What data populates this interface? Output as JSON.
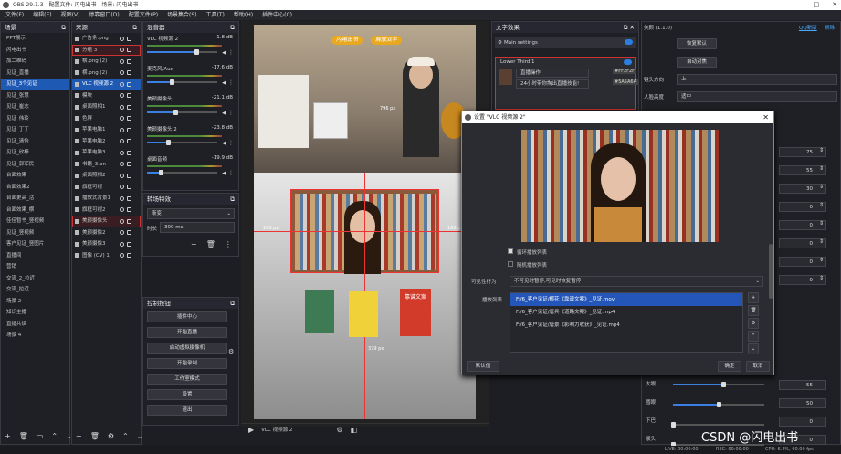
{
  "window": {
    "title": "OBS 29.1.3 - 配置文件: 闪电出书 - 场景: 闪电出书"
  },
  "menu": [
    "文件(F)",
    "编辑(E)",
    "视图(V)",
    "停靠窗口(D)",
    "配置文件(P)",
    "场景集合(S)",
    "工具(T)",
    "帮助(H)",
    "插件中心(C)"
  ],
  "scenes": {
    "title": "场景",
    "items": [
      "PPT展示",
      "闪电出书",
      "加二维码",
      "见证_直播",
      "见证_3个见证",
      "见证_张慧",
      "见证_崔志",
      "见证_伟玲",
      "见证_丁丁",
      "见证_清怡",
      "见证_欣梓",
      "见证_郭军民",
      "台面效果",
      "台面效果2",
      "台面更高_活",
      "台面效果_横",
      "佳佳暂书_竖视频",
      "见证_竖视频",
      "客户见证_竖图片",
      "直播间",
      "营销",
      "交流_2_拉近",
      "交流_拉近",
      "场景 2",
      "知识主播",
      "直播共读",
      "场景 4"
    ],
    "selected": 4
  },
  "sources": {
    "title": "来源",
    "items": [
      "广告条.png",
      "分组 3",
      "横.png (2)",
      "横.png (2)",
      "VLC 视频源 2",
      "模块",
      "桌面照相1",
      "色屏",
      "苹果电脑1",
      "苹果电脑2",
      "苹果电脑3",
      "书籍_3.pn",
      "桌面照相2",
      "旗框可视",
      "播放式背景1",
      "旗框可视2",
      "美颜摄像头",
      "美颜摄像2",
      "美颜摄像3",
      "图像 (CV) 1"
    ],
    "selected": 4,
    "highlighted": [
      1,
      16
    ]
  },
  "mixer": {
    "title": "混音器",
    "channels": [
      {
        "name": "VLC 视频源 2",
        "db": "-1.8 dB",
        "level": 0.7
      },
      {
        "name": "麦克风/Aux",
        "db": "-17.6 dB",
        "level": 0.35
      },
      {
        "name": "美颜摄像头",
        "db": "-21.1 dB",
        "level": 0.4
      },
      {
        "name": "美颜摄像头 2",
        "db": "-23.8 dB",
        "level": 0.3
      },
      {
        "name": "桌面音频",
        "db": "-19.9 dB",
        "level": 0.2
      }
    ]
  },
  "transitions": {
    "title": "转场特效",
    "type": "渐变",
    "duration_label": "时长",
    "duration": "300 ms"
  },
  "controls": {
    "title": "控制按钮",
    "buttons": [
      "插件中心",
      "开始直播",
      "启动虚拟摄像机",
      "开始录制",
      "工作室模式",
      "设置",
      "退出"
    ]
  },
  "preview": {
    "banner_left": "闪电出书",
    "banner_right": "解放双手",
    "dim1": "796 px",
    "dim2": "168 px",
    "dim3": "168 px",
    "dim4": "379 px",
    "book": "靠谱文案"
  },
  "scene_bar": {
    "label": "VLC 视频源 2"
  },
  "text_effects": {
    "title": "文字效果",
    "main": "Main settings",
    "lower": "Lower Third 1",
    "line1": "直播操作",
    "line2": "24小时带你掏出直播技能!",
    "color1": "#FF2F2F",
    "color2": "#5A5A6A"
  },
  "dialog": {
    "title": "设置 \"VLC 视频源 2\"",
    "loop": "循环播放列表",
    "shuffle": "随机播放列表",
    "behavior_label": "可见性行为",
    "behavior": "不可见时暂停,可见时恢复暂停",
    "playlist_label": "播放列表",
    "playlist": [
      "F:/6_客户见证/椰花《靠谱文案》_见证.mov",
      "F:/6_客户见证/唐兵《道路文案》_见证.mp4",
      "F:/6_客户见证/唐景《影响力收获》_见证.mp4"
    ],
    "defaults": "默认值",
    "ok": "确定",
    "cancel": "取消"
  },
  "beauty": {
    "title": "美颜 (1.1.0)",
    "qq": "QQ新版",
    "close": "拆除",
    "restore": "恢复默认",
    "auto": "自动对焦",
    "dir_label": "镜头方向",
    "dir": "上",
    "pos_label": "人脸高度",
    "pos": "适中",
    "values": [
      "75",
      "55",
      "30",
      "0",
      "0",
      "0",
      "0",
      "0"
    ],
    "bottom": [
      {
        "label": "大眼",
        "v": "55"
      },
      {
        "label": "圆眼",
        "v": "50"
      },
      {
        "label": "下巴",
        "v": "0"
      },
      {
        "label": "额头",
        "v": "0"
      }
    ]
  },
  "status": {
    "live": "LIVE: 00:00:00",
    "rec": "REC: 00:00:00",
    "cpu": "CPU: 6.4%, 60.00 fps"
  },
  "watermark": "CSDN @闪电出书"
}
